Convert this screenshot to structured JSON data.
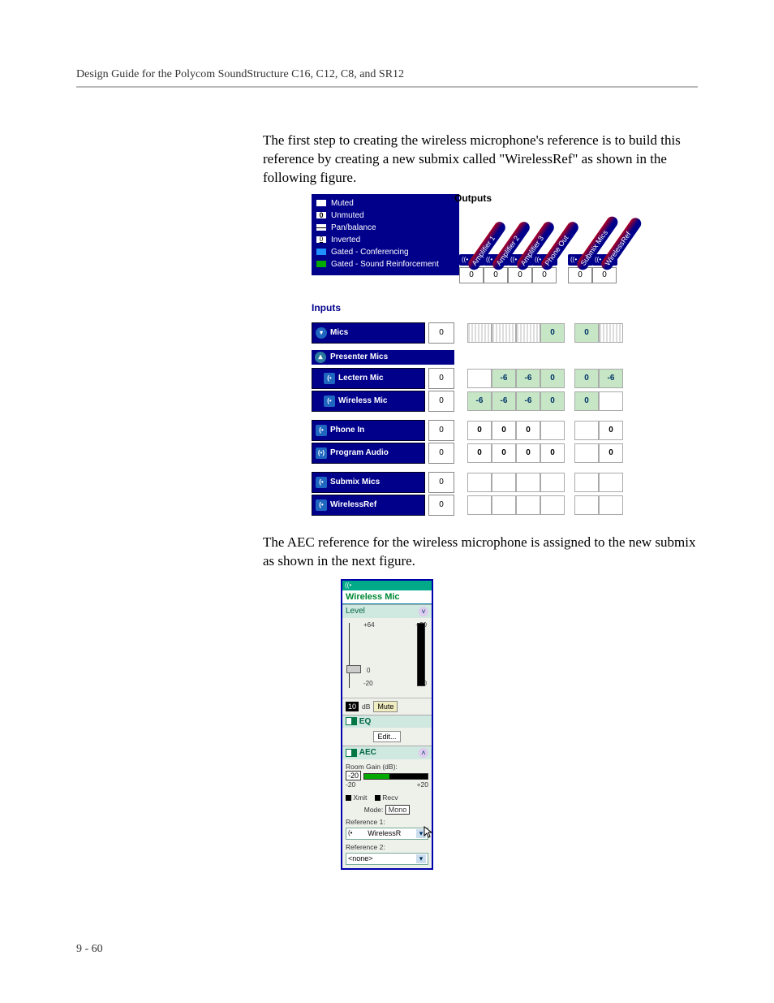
{
  "header": "Design Guide for the Polycom SoundStructure C16, C12, C8, and SR12",
  "footer": "9 - 60",
  "para1": "The first step to creating the wireless microphone's reference is to build this reference by creating a new submix called \"WirelessRef\" as shown in the following figure.",
  "para2": "The AEC reference for the wireless microphone is assigned to the new submix as shown in the next figure.",
  "legend": {
    "muted": "Muted",
    "unmuted": "Unmuted",
    "pan": "Pan/balance",
    "inverted": "Inverted",
    "gated_conf": "Gated - Conferencing",
    "gated_sr": "Gated - Sound Reinforcement"
  },
  "matrix": {
    "outputs_label": "Outputs",
    "inputs_label": "Inputs",
    "columns": [
      "Amplifier 1",
      "Amplifier 2",
      "Amplifier 3",
      "Phone Out",
      "Submix Mics",
      "WirelessRef"
    ],
    "col_fader": [
      "0",
      "0",
      "0",
      "0",
      "0",
      "0"
    ],
    "groups": [
      {
        "label": "Presenter Mics"
      }
    ],
    "rows_group_mics": {
      "label": "Mics",
      "fader": "0",
      "cells": [
        "",
        "",
        "",
        "0",
        "0",
        ""
      ]
    },
    "rows_lectern": {
      "label": "Lectern Mic",
      "fader": "0",
      "cells": [
        "",
        "-6",
        "-6",
        "0",
        "0",
        "-6"
      ]
    },
    "rows_wireless": {
      "label": "Wireless Mic",
      "fader": "0",
      "cells": [
        "-6",
        "-6",
        "-6",
        "0",
        "0",
        ""
      ]
    },
    "rows_phonein": {
      "label": "Phone In",
      "fader": "0",
      "cells": [
        "0",
        "0",
        "0",
        "",
        "",
        "0"
      ]
    },
    "rows_program": {
      "label": "Program Audio",
      "fader": "0",
      "cells": [
        "0",
        "0",
        "0",
        "0",
        "",
        "0"
      ]
    },
    "rows_submixmics": {
      "label": "Submix Mics",
      "fader": "0",
      "cells": [
        "",
        "",
        "",
        "",
        "",
        ""
      ]
    },
    "rows_wirelessref": {
      "label": "WirelessRef",
      "fader": "0",
      "cells": [
        "",
        "",
        "",
        "",
        "",
        ""
      ]
    }
  },
  "wm": {
    "title": "Wireless Mic",
    "level_label": "Level",
    "level_scale_top": "+64",
    "level_scale_mid": "0",
    "level_scale_bot": "-20",
    "level_right_top": "+20",
    "level_right_bot": "-20",
    "gain_value": "10",
    "gain_db": "dB",
    "mute": "Mute",
    "eq_label": "EQ",
    "eq_btn": "Edit...",
    "aec_label": "AEC",
    "room_gain": "Room Gain (dB):",
    "room_gain_val": "-20",
    "rg_min": "-20",
    "rg_max": "+20",
    "xmit": "Xmit",
    "recv": "Recv",
    "mode_label": "Mode:",
    "mode_val": "Mono",
    "ref1_label": "Reference 1:",
    "ref1_val": "WirelessR",
    "ref2_label": "Reference 2:",
    "ref2_val": "<none>"
  }
}
